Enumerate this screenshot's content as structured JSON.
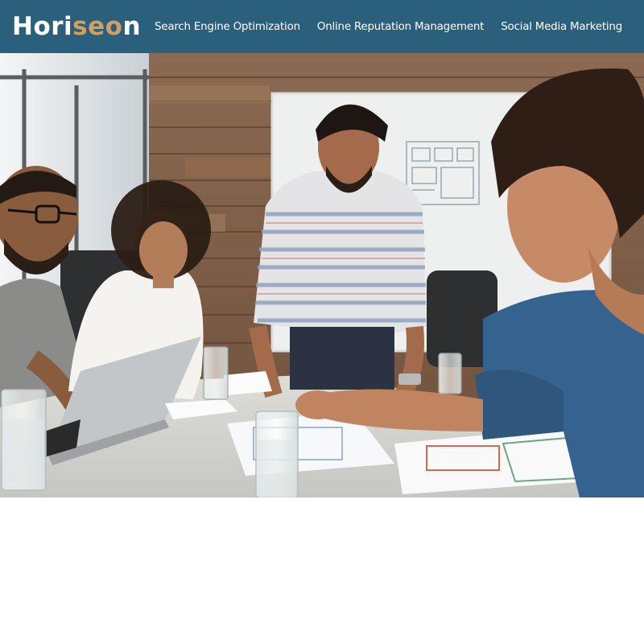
{
  "header": {
    "logo_parts": [
      "Hori",
      "seo",
      "n"
    ],
    "logo_accent_color": "#d29e62",
    "background_color": "#2a607c"
  },
  "nav": {
    "items": [
      {
        "label": "Search Engine Optimization"
      },
      {
        "label": "Online Reputation Management"
      },
      {
        "label": "Social Media Marketing"
      }
    ]
  },
  "hero": {
    "image_subject": "team-meeting-around-table"
  }
}
